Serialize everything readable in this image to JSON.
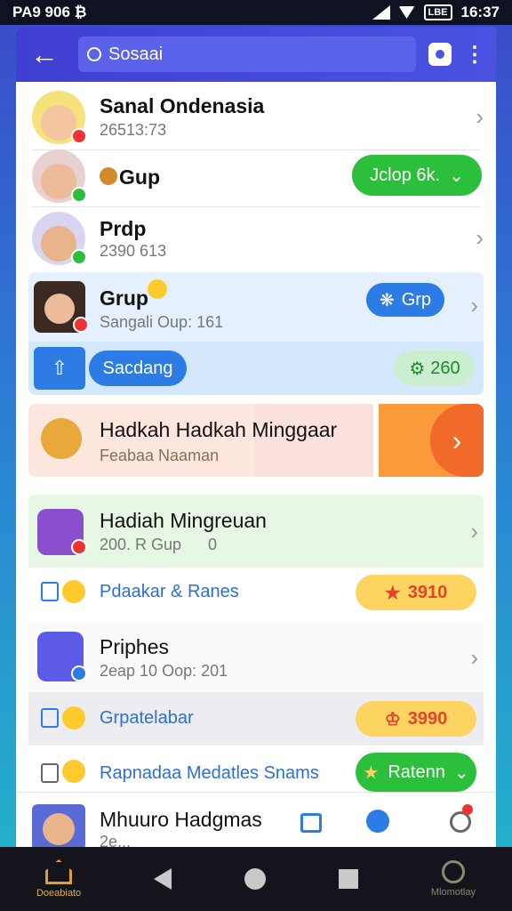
{
  "status_bar": {
    "left_text": "PA9 906 ₿",
    "battery_text": "LBE",
    "time": "16:37"
  },
  "app_bar": {
    "search_text": "Sosaai"
  },
  "rows": [
    {
      "title": "Sanal Ondenasia",
      "subtitle": "26513:73"
    },
    {
      "title": "Gup",
      "action": "Jclop 6k."
    },
    {
      "title": "Prdp",
      "subtitle": "2390 613"
    },
    {
      "title": "Grup",
      "subtitle": "Sangali Oup: 161",
      "action": "Grp"
    }
  ],
  "section_bar": {
    "button": "Sacdang",
    "badge": "260"
  },
  "promo": {
    "title": "Hadkah Hadkah Minggaar",
    "subtitle": "Feabaa Naaman"
  },
  "rows2": [
    {
      "title": "Hadiah Mingreuan",
      "subtitle": "200. R Gup",
      "count": "0"
    },
    {
      "title": "Pdaakar & Ranes",
      "badge": "3910"
    },
    {
      "title": "Priphes",
      "subtitle": "2eap 10 Oop: 201"
    },
    {
      "title": "Grpatelabar",
      "badge": "3990"
    },
    {
      "title": "Rapnadaa Medatles Snams",
      "action": "Ratenn"
    },
    {
      "title": "Mhuuro Hadgmas",
      "subtitle": "2e..."
    }
  ],
  "bottom_nav": {
    "left_label": "Doeabiato",
    "right_label": "Mlomotlay"
  }
}
